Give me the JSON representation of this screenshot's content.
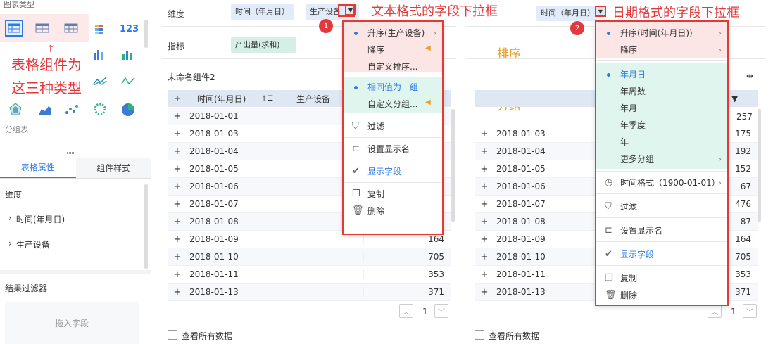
{
  "left_panel": {
    "chart_type_title": "图表类型",
    "annotation_line1": "表格组件为",
    "annotation_line2": "这三种类型",
    "subtype_label": "分组表",
    "tabs": [
      "表格属性",
      "组件样式"
    ],
    "dimension_label": "维度",
    "dimension_items": [
      "时间(年月日)",
      "生产设备"
    ],
    "filter_label": "结果过滤器",
    "drop_hint": "拖入字段"
  },
  "left_table": {
    "dim_label": "维度",
    "dim_fields": [
      "时间（年月日）",
      "生产设备"
    ],
    "metric_label": "指标",
    "metric_field": "产出量(求和)",
    "component_name": "未命名组件2",
    "headers": [
      "时间(年月日)",
      "生产设备"
    ],
    "rows": [
      {
        "date": "2018-01-01",
        "value": "257"
      },
      {
        "date": "2018-01-03",
        "value": "175"
      },
      {
        "date": "2018-01-04",
        "value": "192"
      },
      {
        "date": "2018-01-05",
        "value": "152"
      },
      {
        "date": "2018-01-06",
        "value": "67"
      },
      {
        "date": "2018-01-07",
        "value": "476"
      },
      {
        "date": "2018-01-08",
        "value": "87"
      },
      {
        "date": "2018-01-09",
        "value": "164"
      },
      {
        "date": "2018-01-10",
        "value": "705"
      },
      {
        "date": "2018-01-11",
        "value": "353"
      },
      {
        "date": "2018-01-13",
        "value": "371"
      }
    ],
    "visible_values": [
      "257",
      "175",
      "192",
      "152",
      "67",
      "476",
      "87",
      "164",
      "705",
      "353",
      "371"
    ],
    "page": "1",
    "view_all": "查看所有数据"
  },
  "right_table": {
    "dim_field": "时间（年月日）",
    "rows": [
      "2018-01-03",
      "2018-01-04",
      "2018-01-05",
      "2018-01-06",
      "2018-01-07",
      "2018-01-08",
      "2018-01-09",
      "2018-01-10",
      "2018-01-11",
      "2018-01-13"
    ],
    "values": [
      "257",
      "175",
      "192",
      "152",
      "67",
      "476",
      "87",
      "164",
      "705",
      "353",
      "371"
    ],
    "page": "1",
    "view_all": "查看所有数据"
  },
  "menu1": {
    "sort_items": [
      "升序(生产设备)",
      "降序",
      "自定义排序..."
    ],
    "group_items": [
      "相同值为一组",
      "自定义分组..."
    ],
    "actions": [
      "过滤",
      "设置显示名",
      "显示字段",
      "复制",
      "删除"
    ]
  },
  "menu2": {
    "sort_items": [
      "升序(时间(年月日))",
      "降序"
    ],
    "group_items": [
      "年月日",
      "年周数",
      "年月",
      "年季度",
      "年",
      "更多分组"
    ],
    "time_format": "时间格式（1900-01-01）",
    "actions": [
      "过滤",
      "设置显示名",
      "显示字段",
      "复制",
      "删除"
    ]
  },
  "annotations": {
    "text_dropdown": "文本格式的字段下拉框",
    "date_dropdown": "日期格式的字段下拉框",
    "sort": "排序",
    "group": "分组",
    "badge1": "1",
    "badge2": "2"
  },
  "colors": {
    "accent": "#2c7be5",
    "red": "#e4393c",
    "orange": "#f29b1b"
  }
}
